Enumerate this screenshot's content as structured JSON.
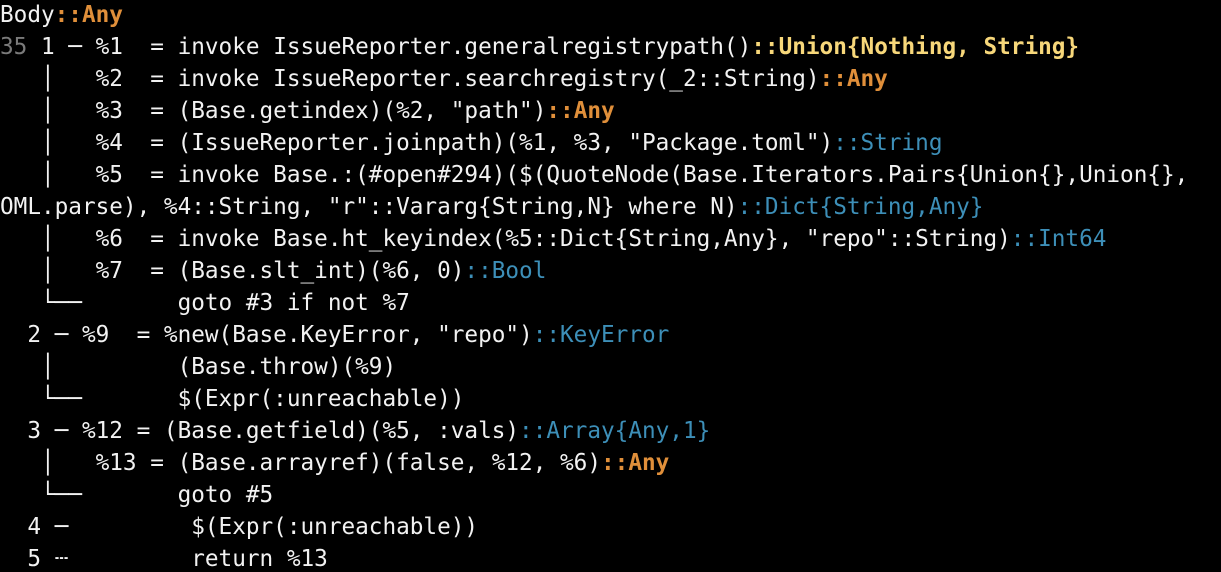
{
  "terminal": {
    "background": "#000000",
    "palette": {
      "default": "#f2f2f2",
      "type_any": "#e08f3a",
      "type_union": "#f7d77a",
      "type_concrete": "#3d8fb8",
      "line_number": "#7a7a7a"
    },
    "lines": [
      [
        {
          "c": "w",
          "t": "Body"
        },
        {
          "c": "ob",
          "t": "::Any"
        }
      ],
      [
        {
          "c": "g",
          "t": "35"
        },
        {
          "c": "w",
          "t": " 1 ─ %1  = invoke IssueReporter.generalregistrypath()"
        },
        {
          "c": "y",
          "t": "::Union{Nothing, String}"
        }
      ],
      [
        {
          "c": "w",
          "t": "   │   %2  = invoke IssueReporter.searchregistry(_2::String)"
        },
        {
          "c": "ob",
          "t": "::Any"
        }
      ],
      [
        {
          "c": "w",
          "t": "   │   %3  = (Base.getindex)(%2, \"path\")"
        },
        {
          "c": "ob",
          "t": "::Any"
        }
      ],
      [
        {
          "c": "w",
          "t": "   │   %4  = (IssueReporter.joinpath)(%1, %3, \"Package.toml\")"
        },
        {
          "c": "b",
          "t": "::String"
        }
      ],
      [
        {
          "c": "w",
          "t": "   │   %5  = invoke Base.:(#open#294)($(QuoteNode(Base.Iterators.Pairs{Union{},Union{},"
        }
      ],
      [
        {
          "c": "w",
          "t": "OML.parse), %4::String, \"r\"::Vararg{String,N} where N)"
        },
        {
          "c": "b",
          "t": "::Dict{String,Any}"
        }
      ],
      [
        {
          "c": "w",
          "t": "   │   %6  = invoke Base.ht_keyindex(%5::Dict{String,Any}, \"repo\"::String)"
        },
        {
          "c": "b",
          "t": "::Int64"
        }
      ],
      [
        {
          "c": "w",
          "t": "   │   %7  = (Base.slt_int)(%6, 0)"
        },
        {
          "c": "b",
          "t": "::Bool"
        }
      ],
      [
        {
          "c": "w",
          "t": "   └──       goto #3 if not %7"
        }
      ],
      [
        {
          "c": "w",
          "t": "  2 ─ %9  = %new(Base.KeyError, \"repo\")"
        },
        {
          "c": "b",
          "t": "::KeyError"
        }
      ],
      [
        {
          "c": "w",
          "t": "   │         (Base.throw)(%9)"
        }
      ],
      [
        {
          "c": "w",
          "t": "   └──       $(Expr(:unreachable))"
        }
      ],
      [
        {
          "c": "w",
          "t": "  3 ─ %12 = (Base.getfield)(%5, :vals)"
        },
        {
          "c": "b",
          "t": "::Array{Any,1}"
        }
      ],
      [
        {
          "c": "w",
          "t": "   │   %13 = (Base.arrayref)(false, %12, %6)"
        },
        {
          "c": "ob",
          "t": "::Any"
        }
      ],
      [
        {
          "c": "w",
          "t": "   └──       goto #5"
        }
      ],
      [
        {
          "c": "w",
          "t": "  4 ─         $(Expr(:unreachable))"
        }
      ],
      [
        {
          "c": "w",
          "t": "  5 ┄         return %13"
        }
      ]
    ]
  }
}
